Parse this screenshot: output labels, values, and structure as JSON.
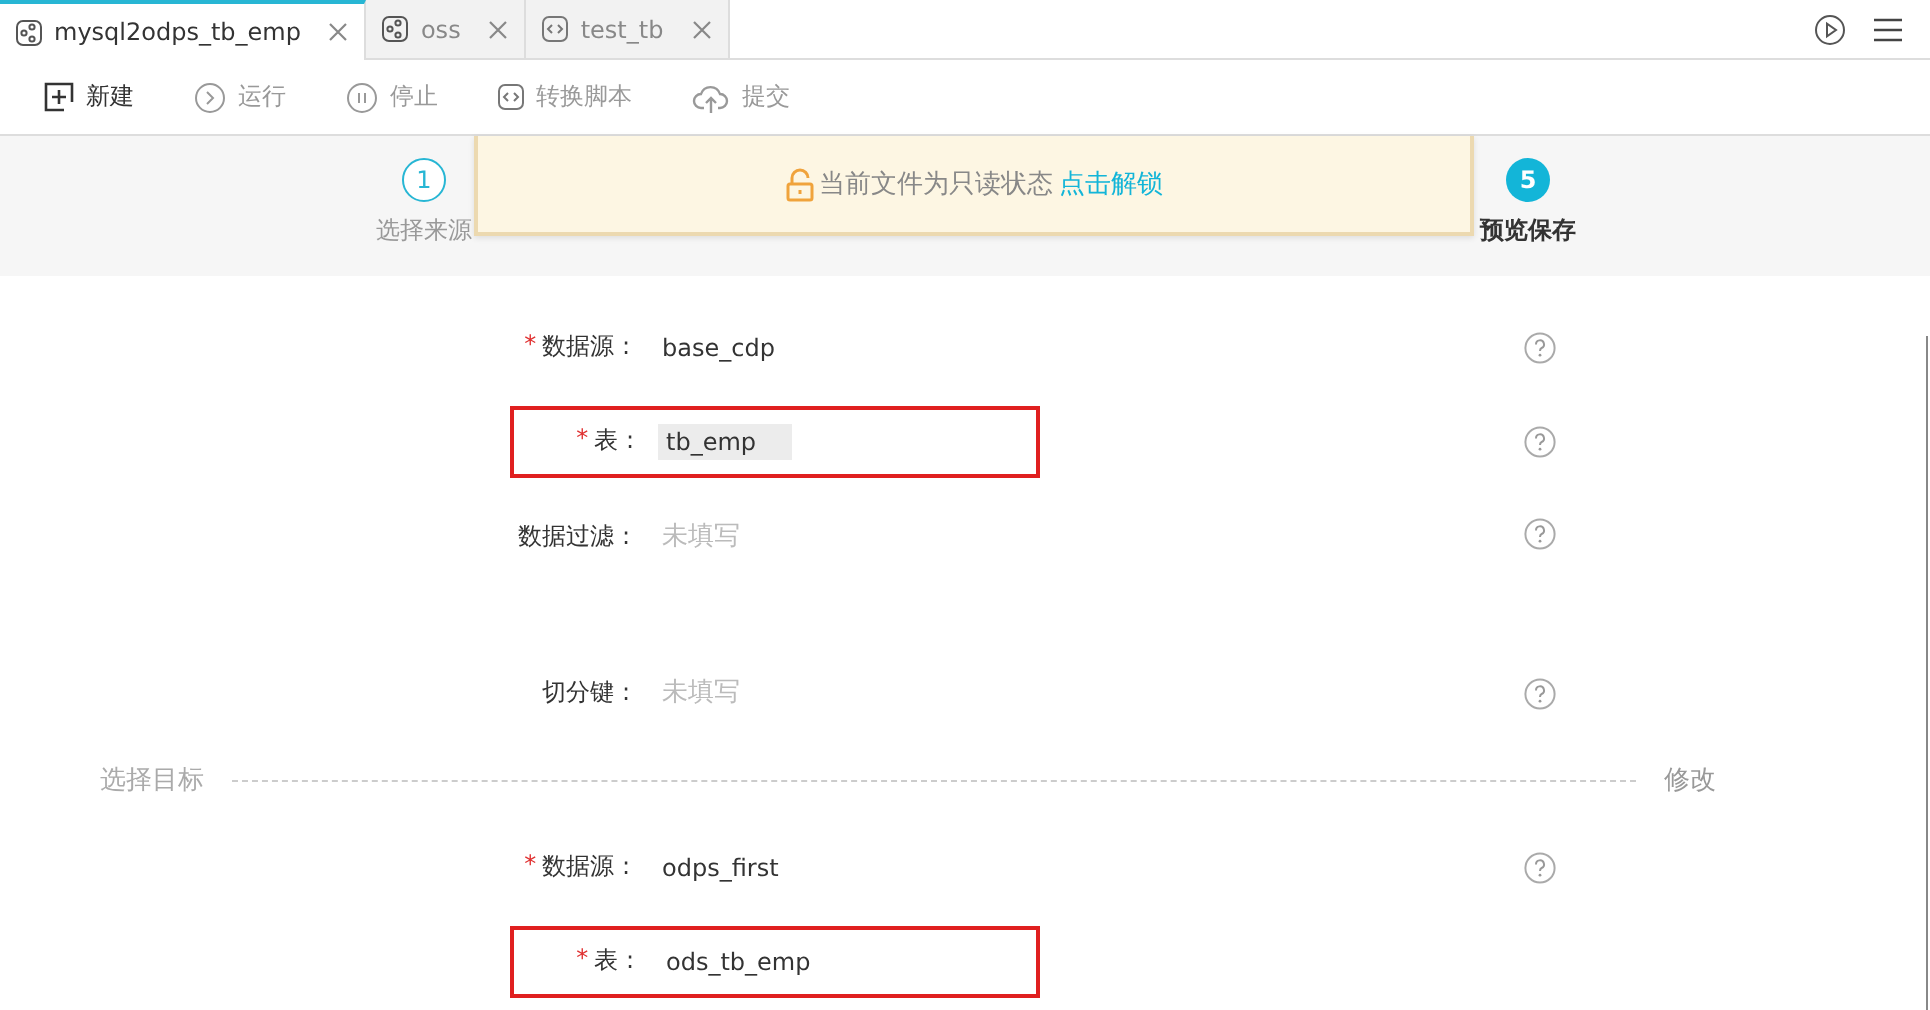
{
  "tabs": [
    {
      "label": "mysql2odps_tb_emp",
      "kind": "workflow",
      "selected": true
    },
    {
      "label": "oss",
      "kind": "workflow",
      "selected": false
    },
    {
      "label": "test_tb",
      "kind": "script",
      "selected": false
    }
  ],
  "toolbar": [
    {
      "label": "新建",
      "disabled": false
    },
    {
      "label": "运行",
      "disabled": true
    },
    {
      "label": "停止",
      "disabled": true
    },
    {
      "label": "转换脚本",
      "disabled": true
    },
    {
      "label": "提交",
      "disabled": true
    }
  ],
  "steps": [
    {
      "number": "1",
      "label": "选择来源",
      "selected": false
    },
    {
      "number": "5",
      "label": "预览保存",
      "selected": true
    }
  ],
  "notice": {
    "text": "当前文件为只读状态",
    "link": "点击解锁"
  },
  "source_fields": [
    {
      "required_mark": "*",
      "label": "数据源 :",
      "kind": "text",
      "value": "base_cdp",
      "highlighted": false,
      "tall": false
    },
    {
      "required_mark": "*",
      "label": "表 :",
      "kind": "filled",
      "value": "tb_emp",
      "highlighted": true,
      "tall": false
    },
    {
      "label": "数据过滤 :",
      "kind": "empty",
      "placeholder": "未填写",
      "highlighted": false,
      "tall": true
    },
    {
      "label": "切分键 :",
      "kind": "empty",
      "placeholder": "未填写",
      "highlighted": false,
      "tall": false
    }
  ],
  "target_section": {
    "title": "选择目标",
    "action": "修改"
  },
  "target_fields": [
    {
      "required_mark": "*",
      "label": "数据源 :",
      "kind": "text",
      "value": "odps_first",
      "highlighted": false,
      "help": true
    },
    {
      "required_mark": "*",
      "label": "表 :",
      "kind": "text",
      "value": "ods_tb_emp",
      "highlighted": true,
      "help": false
    }
  ]
}
